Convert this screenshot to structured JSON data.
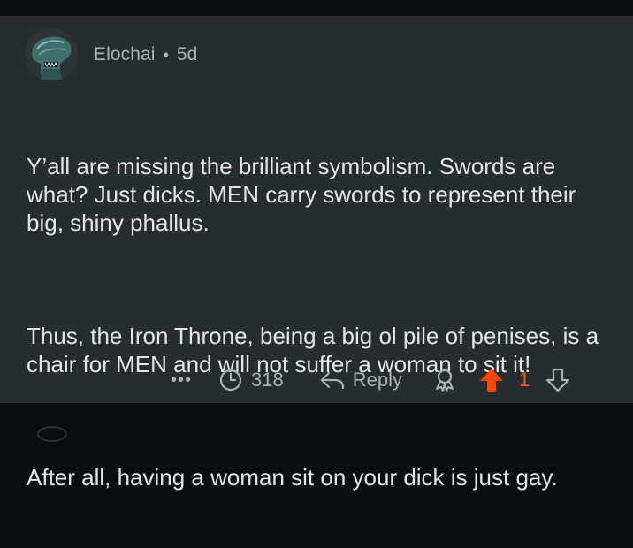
{
  "comment": {
    "username": "Elochai",
    "separator": "•",
    "age": "5d",
    "paragraphs": [
      "Y’all are missing the brilliant symbolism. Swords are what? Just dicks. MEN carry swords to represent their big, shiny phallus.",
      "Thus, the Iron Throne, being a big ol pile of penises, is a chair for MEN and will not suffer a woman to sit it!",
      "After all, having a woman sit on your dick is just gay."
    ]
  },
  "actions": {
    "more_label": "•••",
    "views": "318",
    "reply_label": "Reply",
    "score": "1"
  },
  "colors": {
    "background": "#272c2e",
    "text": "#e3e6e8",
    "muted": "#a9b2b6",
    "upvote_active": "#ff4500"
  },
  "icons": {
    "avatar": "alien-avatar",
    "views": "clock-icon",
    "reply": "reply-arrow-icon",
    "award": "award-icon",
    "upvote": "upvote-arrow-icon",
    "downvote": "downvote-arrow-icon"
  }
}
